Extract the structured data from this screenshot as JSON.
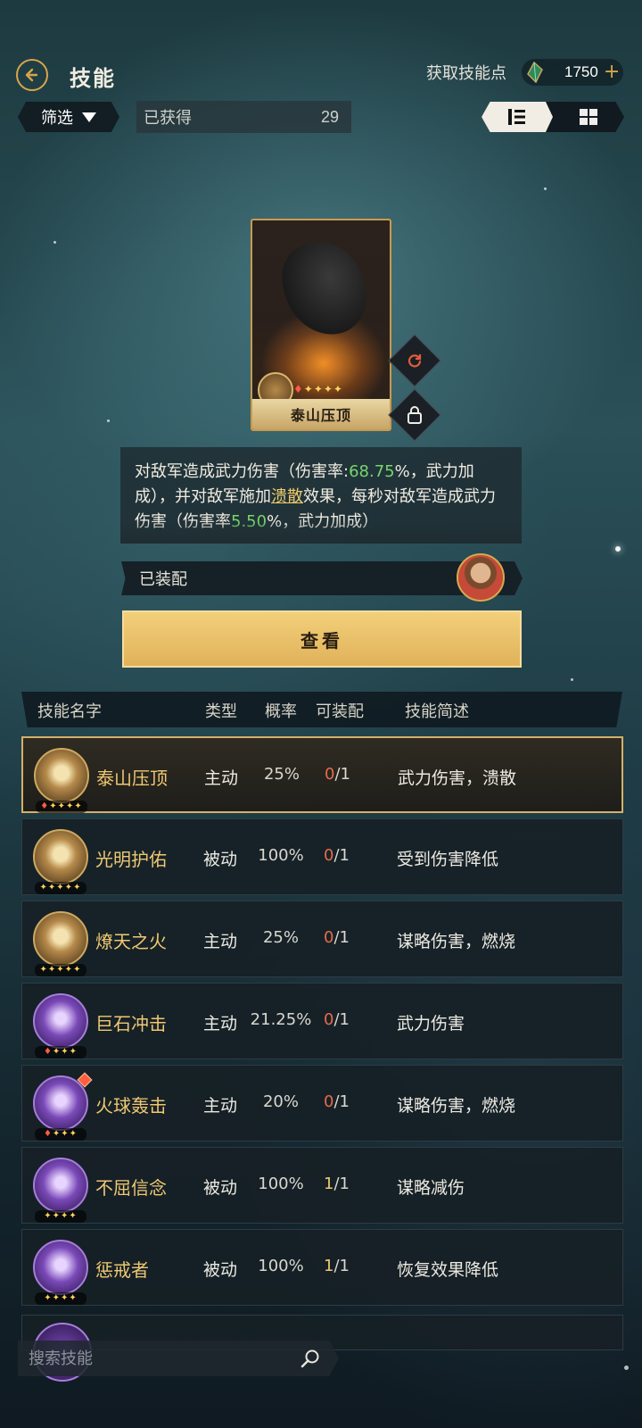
{
  "header": {
    "title": "技能",
    "skill_points_label": "获取技能点",
    "skill_points_value": "1750"
  },
  "toolbar": {
    "filter_label": "筛选",
    "obtained_label": "已获得",
    "obtained_count": "29"
  },
  "selected_skill": {
    "name": "泰山压顶",
    "description_parts": {
      "p1": "对敌军造成武力伤害（伤害率:",
      "rate": "68.75",
      "p2": "%，武力加成），并对敌军施加",
      "effect": "溃散",
      "p3": "效果，每秒对敌军造成武力伤害（伤害率",
      "rate2": "5.50",
      "p4": "%，武力加成）"
    },
    "equipped_label": "已装配",
    "view_button": "查看"
  },
  "table": {
    "headers": {
      "name": "技能名字",
      "type": "类型",
      "rate": "概率",
      "equip": "可装配",
      "brief": "技能简述"
    },
    "rows": [
      {
        "name": "泰山压顶",
        "type": "主动",
        "rate": "25%",
        "equip_current": "0",
        "equip_total": "/1",
        "brief": "武力伤害，溃散",
        "icon": "boulder-icon",
        "stars": "♦✦✦✦✦"
      },
      {
        "name": "光明护佑",
        "type": "被动",
        "rate": "100%",
        "equip_current": "0",
        "equip_total": "/1",
        "brief": "受到伤害降低",
        "icon": "light-shield-icon",
        "stars": "✦✦✦✦✦"
      },
      {
        "name": "燎天之火",
        "type": "主动",
        "rate": "25%",
        "equip_current": "0",
        "equip_total": "/1",
        "brief": "谋略伤害，燃烧",
        "icon": "fire-icon",
        "stars": "✦✦✦✦✦"
      },
      {
        "name": "巨石冲击",
        "type": "主动",
        "rate": "21.25%",
        "equip_current": "0",
        "equip_total": "/1",
        "brief": "武力伤害",
        "icon": "rock-impact-icon",
        "stars": "♦✦✦✦"
      },
      {
        "name": "火球轰击",
        "type": "主动",
        "rate": "20%",
        "equip_current": "0",
        "equip_total": "/1",
        "brief": "谋略伤害，燃烧",
        "icon": "fireball-icon",
        "stars": "♦✦✦✦"
      },
      {
        "name": "不屈信念",
        "type": "被动",
        "rate": "100%",
        "equip_current": "1",
        "equip_total": "/1",
        "brief": "谋略减伤",
        "icon": "banner-icon",
        "stars": "✦✦✦✦"
      },
      {
        "name": "惩戒者",
        "type": "被动",
        "rate": "100%",
        "equip_current": "1",
        "equip_total": "/1",
        "brief": "恢复效果降低",
        "icon": "punisher-icon",
        "stars": "✦✦✦✦"
      }
    ]
  },
  "search": {
    "placeholder": "搜索技能"
  },
  "colors": {
    "accent_gold": "#d7a54a",
    "skill_name": "#efc872",
    "unavailable_count": "#e86a4a",
    "highlight_green": "#78d56a"
  }
}
